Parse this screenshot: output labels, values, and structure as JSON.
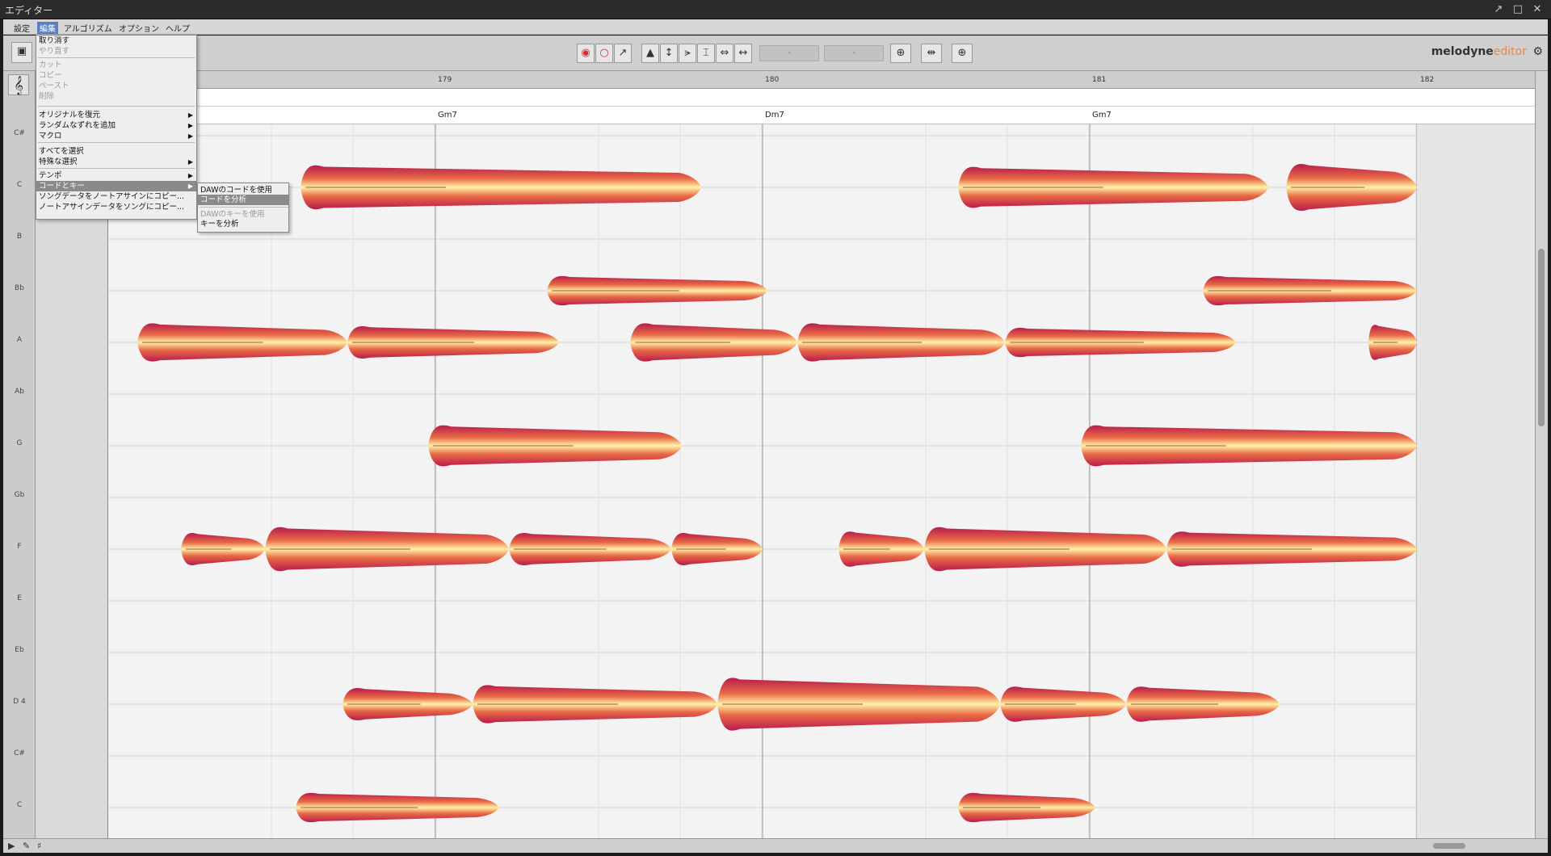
{
  "window": {
    "title": "エディター"
  },
  "menubar": {
    "items": [
      "設定",
      "編集",
      "アルゴリズム",
      "オプション",
      "ヘルプ"
    ]
  },
  "edit_menu": {
    "items": [
      {
        "label": "取り消す",
        "enabled": true
      },
      {
        "label": "やり直す",
        "enabled": false
      },
      {
        "label": "カット",
        "enabled": false
      },
      {
        "label": "コピー",
        "enabled": false
      },
      {
        "label": "ペースト",
        "enabled": false
      },
      {
        "label": "削除",
        "enabled": false
      },
      {
        "label": "オリジナルを復元",
        "enabled": true,
        "submenu": true
      },
      {
        "label": "ランダムなずれを追加",
        "enabled": true,
        "submenu": true
      },
      {
        "label": "マクロ",
        "enabled": true,
        "submenu": true
      },
      {
        "label": "すべてを選択",
        "enabled": true
      },
      {
        "label": "特殊な選択",
        "enabled": true,
        "submenu": true
      },
      {
        "label": "テンポ",
        "enabled": true,
        "submenu": true
      },
      {
        "label": "コードとキー",
        "enabled": true,
        "submenu": true,
        "highlighted": true
      },
      {
        "label": "ソングデータをノートアサインにコピー...",
        "enabled": true
      },
      {
        "label": "ノートアサインデータをソングにコピー...",
        "enabled": true
      }
    ]
  },
  "chord_key_submenu": {
    "items": [
      {
        "label": "DAWのコードを使用",
        "enabled": true
      },
      {
        "label": "コードを分析",
        "enabled": true,
        "highlighted": true
      },
      {
        "label": "DAWのキーを使用",
        "enabled": false
      },
      {
        "label": "キーを分析",
        "enabled": true
      }
    ]
  },
  "toolbar": {
    "field1": "-",
    "field2": "-"
  },
  "brand": {
    "name": "melodyne",
    "suffix": "editor"
  },
  "ruler": {
    "bars": [
      "179",
      "180",
      "181",
      "182"
    ]
  },
  "chords": [
    "Gm7",
    "Dm7",
    "Gm7"
  ],
  "pitches": [
    "C#",
    "C",
    "B",
    "Bb",
    "A",
    "Ab",
    "G",
    "Gb",
    "F",
    "E",
    "Eb",
    "D 4",
    "C#",
    "C"
  ],
  "colors": {
    "blob_outer": "#c8234f",
    "blob_inner": "#fff0a0",
    "menu_highlight": "#8a8a8a"
  }
}
